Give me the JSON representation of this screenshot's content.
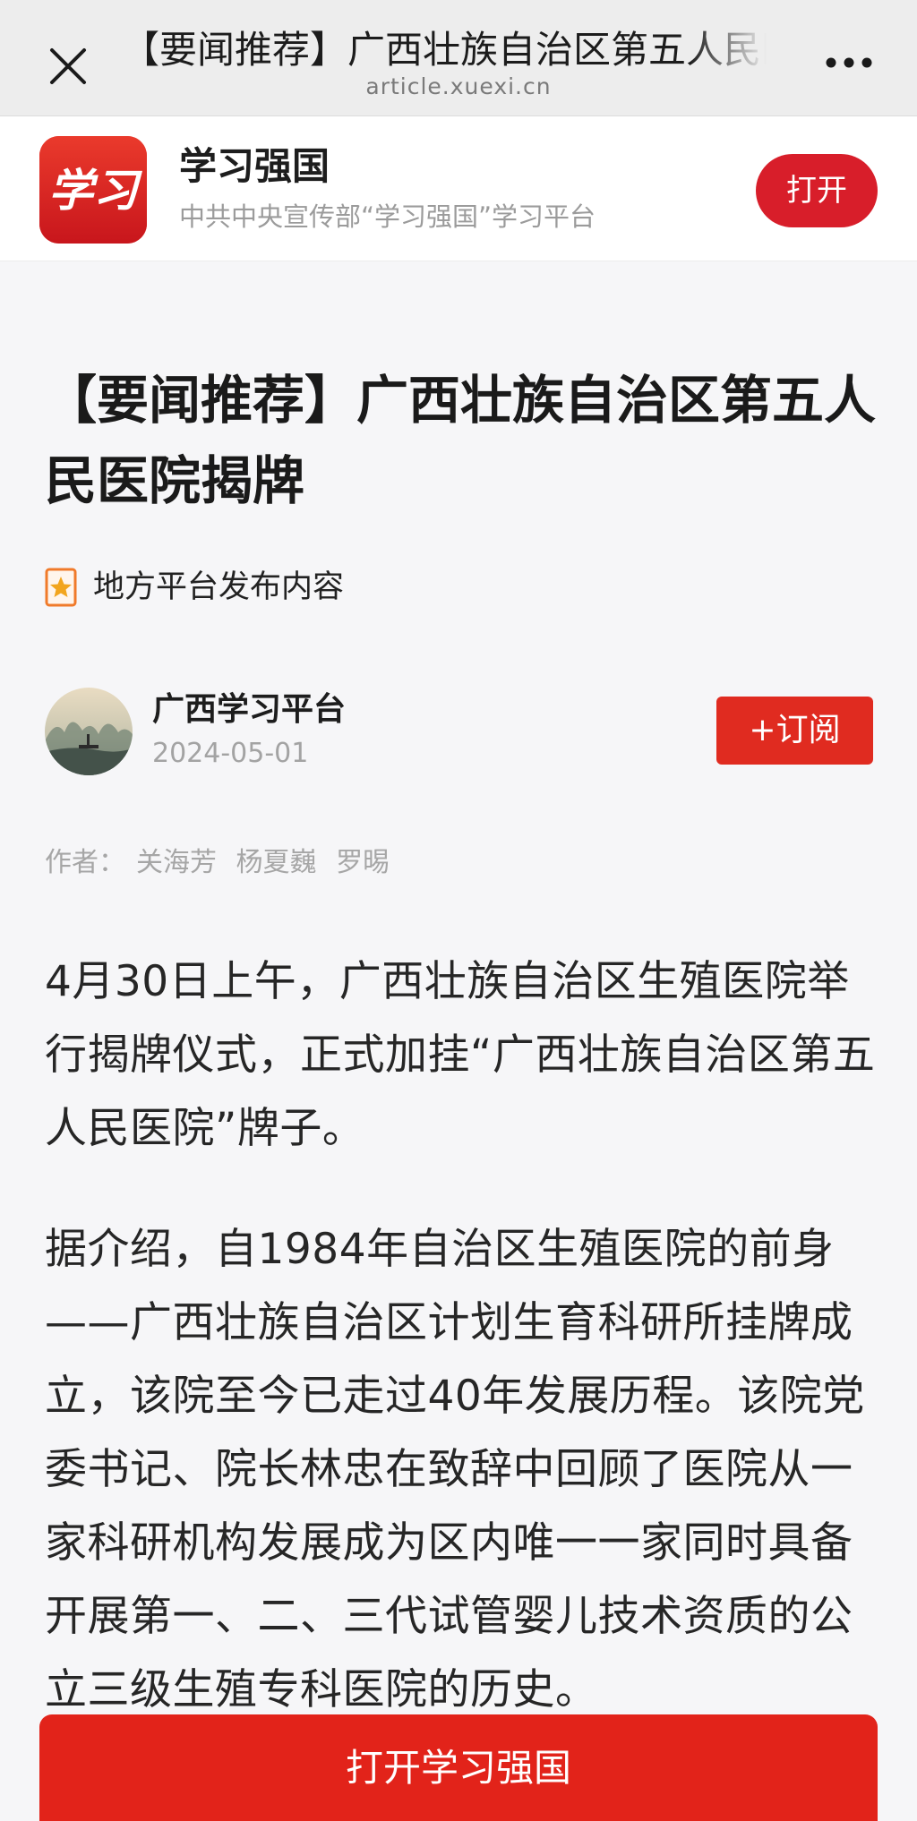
{
  "browser": {
    "title": "【要闻推荐】广西壮族自治区第五人民医院揭牌",
    "domain": "article.xuexi.cn",
    "close_icon": "close-icon",
    "more_icon": "more-icon"
  },
  "app_banner": {
    "logo_text": "学习",
    "name": "学习强国",
    "slogan": "中共中央宣传部“学习强国”学习平台",
    "open_label": "打开"
  },
  "article": {
    "headline": "【要闻推荐】广西壮族自治区第五人民医院揭牌",
    "source_label": "地方平台发布内容",
    "source_icon": "star-badge-icon",
    "publisher": "广西学习平台",
    "date": "2024-05-01",
    "subscribe_label": "+订阅",
    "byline_label": "作者：",
    "authors": [
      "关海芳",
      "杨夏巍",
      "罗晹"
    ],
    "paragraphs": [
      "4月30日上午，广西壮族自治区生殖医院举行揭牌仪式，正式加挂“广西壮族自治区第五人民医院”牌子。",
      "据介绍，自1984年自治区生殖医院的前身——广西壮族自治区计划生育科研所挂牌成立，该院至今已走过40年发展历程。该院党委书记、院长林忠在致辞中回顾了医院从一家科研机构发展成为区内唯一一家同时具备开展第一、二、三代试管婴儿技术资质的公立三级生殖专科医院的历史。"
    ]
  },
  "cta": {
    "label": "打开学习强国"
  },
  "colors": {
    "brand_red": "#e1251b",
    "topbar_bg": "#ededed",
    "page_bg": "#f6f6f8"
  }
}
